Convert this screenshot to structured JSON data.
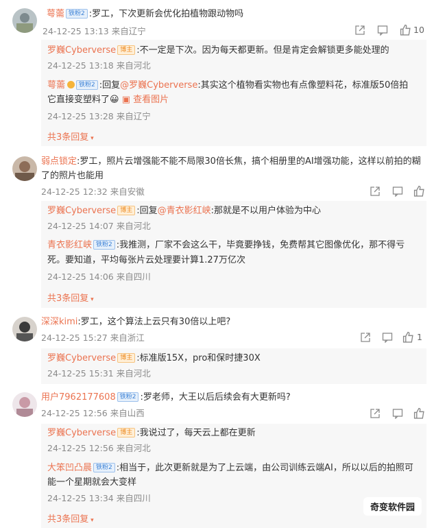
{
  "comments": [
    {
      "user": "萼薷",
      "badge": "铁粉2",
      "text": ":罗工，下次更新会优化拍植物跟动物吗",
      "time": "24-12-25 13:13",
      "location": "来自辽宁",
      "likes": "10",
      "replies": [
        {
          "user": "罗巍Cyberverse",
          "badge": "博主",
          "text": ":不一定是下次。因为每天都更新。但是肯定会解锁更多能处理的",
          "time": "24-12-25 13:18",
          "location": "来自河北"
        },
        {
          "user": "萼薷",
          "badge": "铁粉2",
          "reply_prefix": ":回复",
          "reply_to": "@罗巍Cyberverse",
          "text": ":其实这个植物看实物也有点像塑料花，标准版50倍拍",
          "text2": "它直接变塑料了",
          "emoji": "😀",
          "view_image": "查看图片",
          "time": "24-12-25 13:28",
          "location": "来自辽宁"
        }
      ],
      "more": "共3条回复"
    },
    {
      "user": "弱点锁定",
      "text": ":罗工，照片云增强能不能不局限30倍长焦，搞个相册里的AI增强功能，这样以前拍的糊",
      "text2": "了的照片也能用",
      "time": "24-12-25 12:32",
      "location": "来自安徽",
      "replies": [
        {
          "user": "罗巍Cyberverse",
          "badge": "博主",
          "reply_prefix": ":回复",
          "reply_to": "@青衣影红峡",
          "text": ":那就是不以用户体验为中心",
          "time": "24-12-25 14:07",
          "location": "来自河北"
        },
        {
          "user": "青衣影红峡",
          "badge": "铁粉2",
          "text": ":我推测，厂家不会这么干，毕竟要挣钱，免费帮其它图像优化，那不得亏",
          "text2": "死。要知道，平均每张片云处理要计算1.27万亿次",
          "time": "24-12-25 14:06",
          "location": "来自四川"
        }
      ],
      "more": "共3条回复"
    },
    {
      "user": "深深kimi",
      "text": ":罗工，这个算法上云只有30倍以上吧?",
      "time": "24-12-25 15:27",
      "location": "来自浙江",
      "likes": "1",
      "replies": [
        {
          "user": "罗巍Cyberverse",
          "badge": "博主",
          "text": ":标准版15X，pro和保时捷30X",
          "time": "24-12-25 15:31",
          "location": "来自河北"
        }
      ]
    },
    {
      "user": "用户7962177608",
      "badge": "铁粉2",
      "text": ":罗老师，大王以后后续会有大更新吗?",
      "time": "24-12-25 12:56",
      "location": "来自山西",
      "replies": [
        {
          "user": "罗巍Cyberverse",
          "badge": "博主",
          "text": ":我说过了，每天云上都在更新",
          "time": "24-12-25 12:56",
          "location": "来自河北"
        },
        {
          "user": "大笨凹凸晨",
          "badge": "铁粉2",
          "text": ":相当于，此次更新就是为了上云端，由公司训练云端AI，所以以后的拍照可",
          "text2": "能一个星期就会大变样",
          "time": "24-12-25 13:34",
          "location": "来自四川"
        }
      ],
      "more": "共3条回复"
    }
  ],
  "watermark": "奇变软件园",
  "colors": {
    "accent": "#eb7350",
    "meta": "#8a8a8a",
    "reply_bg": "#f7f7f7"
  }
}
